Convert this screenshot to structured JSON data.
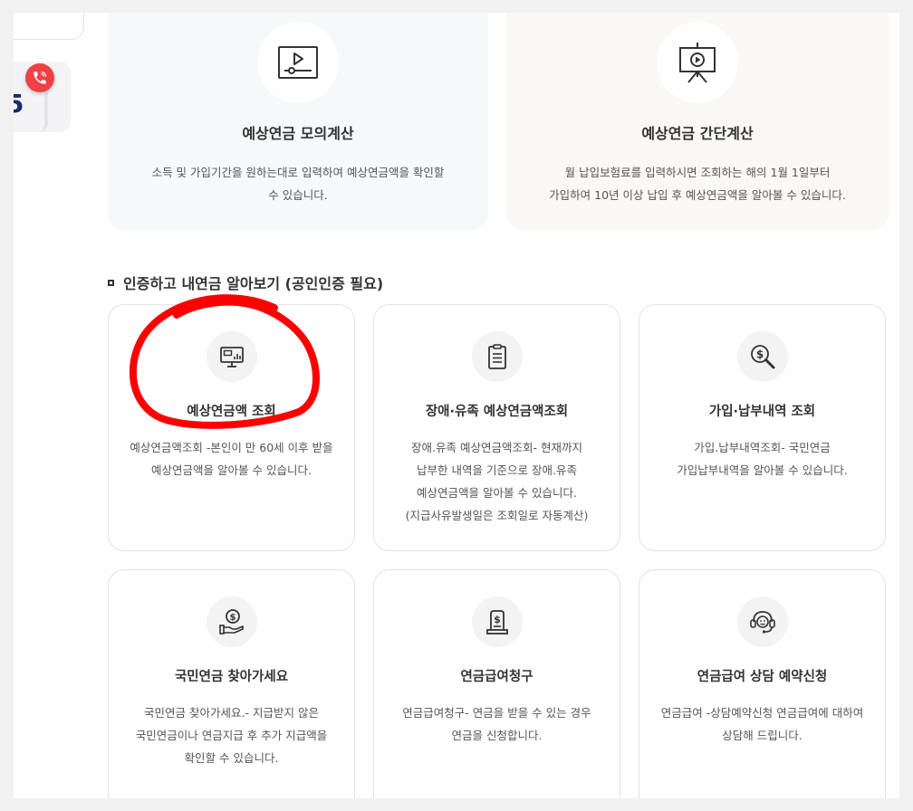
{
  "colors": {
    "accent_red": "#ef4045",
    "annotation_red": "#ff0000",
    "text_dark": "#333333",
    "text_body": "#555555",
    "side_digit": "#1d2a6b"
  },
  "side": {
    "digit": "5",
    "call_icon": "phone-call-icon"
  },
  "top_cards": [
    {
      "icon": "video-player-icon",
      "title": "예상연금 모의계산",
      "desc_line1": "소득 및 가입기간을 원하는대로 입력하여 예상연금액을 확인할",
      "desc_line2": "수 있습니다."
    },
    {
      "icon": "presentation-board-icon",
      "title": "예상연금 간단계산",
      "desc_line1": "월 납입보험료를 입력하시면 조회하는 해의 1월 1일부터",
      "desc_line2": "가입하여 10년 이상 납입 후 예상연금액을 알아볼 수 있습니다."
    }
  ],
  "section": {
    "title": "인증하고 내연금 알아보기 (공인인증 필요)"
  },
  "cards": [
    {
      "icon": "monitor-chart-icon",
      "title": "예상연금액 조회",
      "lines": [
        "예상연금액조회 -본인이 만 60세 이후 받을",
        "예상연금액을 알아볼 수 있습니다."
      ]
    },
    {
      "icon": "clipboard-document-icon",
      "title": "장애·유족 예상연금액조회",
      "lines": [
        "장애.유족 예상연금액조회- 현재까지",
        "납부한 내역을 기준으로 장애.유족",
        "예상연금액을 알아볼 수 있습니다.",
        "(지급사유발생일은 조회일로 자동계산)"
      ]
    },
    {
      "icon": "money-magnifier-icon",
      "title": "가입·납부내역 조회",
      "lines": [
        "가입.납부내역조회- 국민연금",
        "가입납부내역을 알아볼 수 있습니다."
      ]
    },
    {
      "icon": "hand-coin-icon",
      "title": "국민연금 찾아가세요",
      "lines": [
        "국민연금 찾아가세요.- 지급받지 않은",
        "국민연금이나 연금지급 후 추가 지급액을",
        "확인할 수 있습니다."
      ]
    },
    {
      "icon": "money-document-icon",
      "title": "연금급여청구",
      "lines": [
        "연금급여청구- 연금을 받을 수 있는 경우",
        "연금을 신청합니다."
      ]
    },
    {
      "icon": "headset-consult-icon",
      "title": "연금급여 상담 예약신청",
      "lines": [
        "연금급여 -상담예약신청 연금급여에 대하여",
        "상담해 드립니다."
      ]
    }
  ]
}
